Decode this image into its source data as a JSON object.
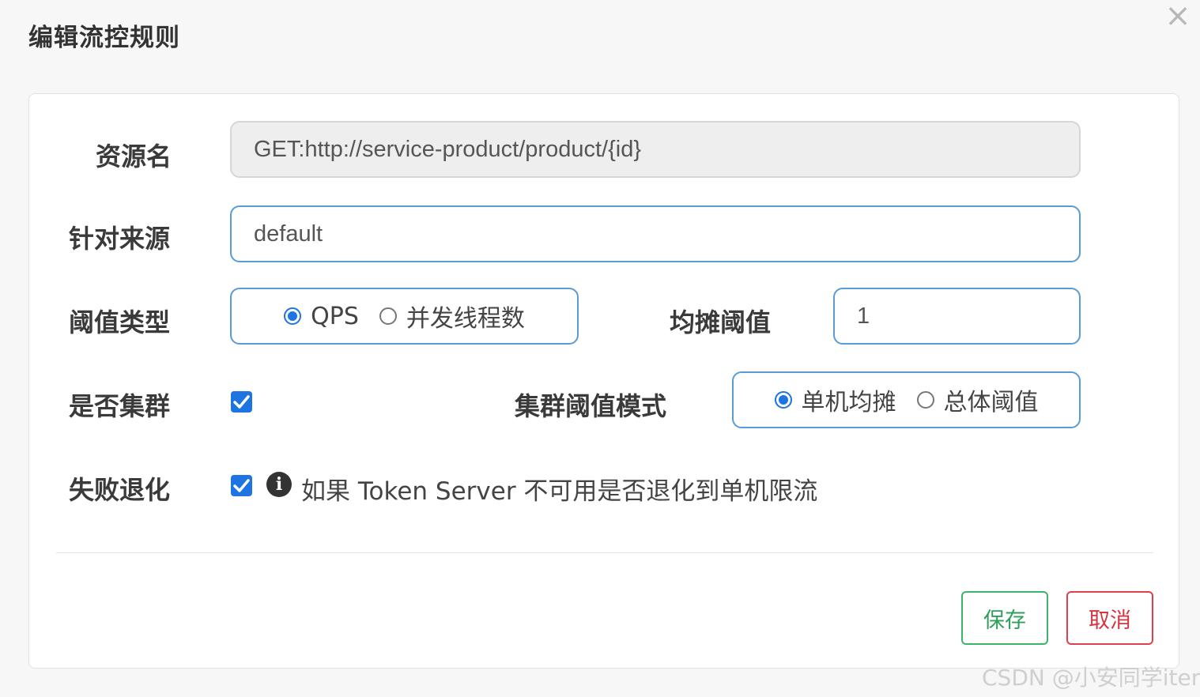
{
  "dialog": {
    "title": "编辑流控规则",
    "close_glyph": "×"
  },
  "form": {
    "resource": {
      "label": "资源名",
      "value": "GET:http://service-product/product/{id}"
    },
    "limit_app": {
      "label": "针对来源",
      "value": "default"
    },
    "grade": {
      "label": "阈值类型",
      "options": [
        {
          "label": "QPS",
          "checked": true
        },
        {
          "label": "并发线程数",
          "checked": false
        }
      ]
    },
    "threshold": {
      "label": "均摊阈值",
      "value": "1"
    },
    "cluster": {
      "label": "是否集群",
      "checked": true
    },
    "cluster_mode": {
      "label": "集群阈值模式",
      "options": [
        {
          "label": "单机均摊",
          "checked": true
        },
        {
          "label": "总体阈值",
          "checked": false
        }
      ]
    },
    "fallback": {
      "label": "失败退化",
      "checked": true,
      "hint": "如果 Token Server 不可用是否退化到单机限流"
    }
  },
  "buttons": {
    "save": "保存",
    "cancel": "取消"
  },
  "watermark": "CSDN @小安同学iter",
  "colors": {
    "accent": "#1e74e0",
    "input_border": "#5b9bd5",
    "save": "#2ea05a",
    "cancel": "#d8343f"
  }
}
